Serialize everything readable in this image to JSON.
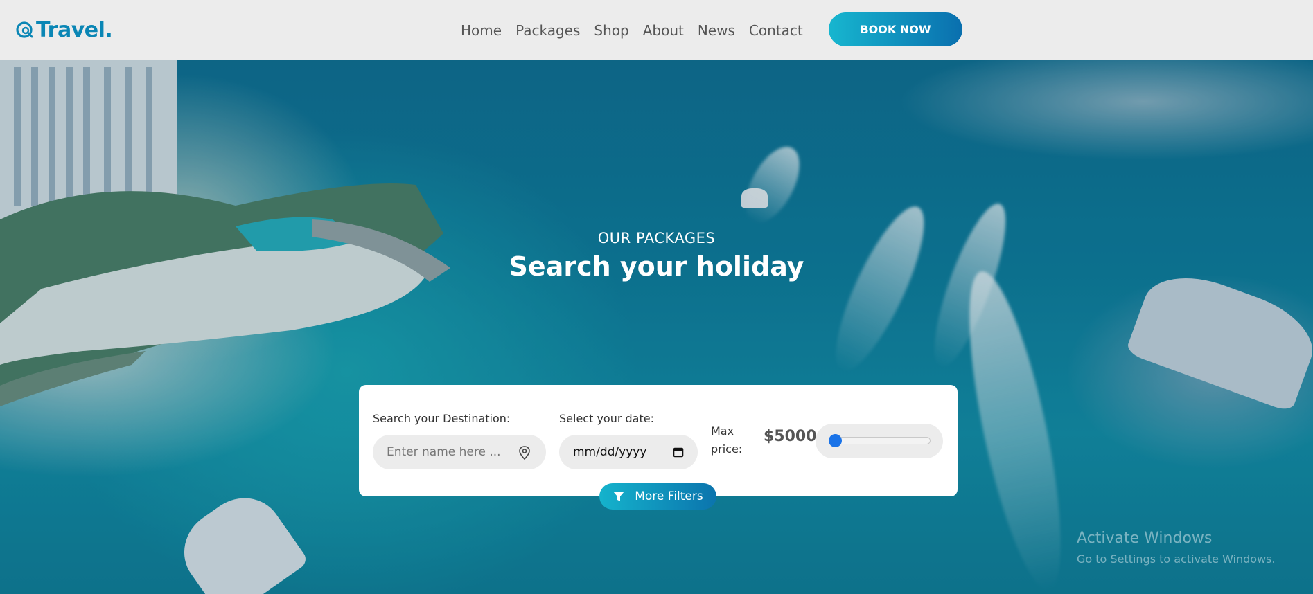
{
  "brand": {
    "name": "Travel."
  },
  "nav": {
    "links": [
      "Home",
      "Packages",
      "Shop",
      "About",
      "News",
      "Contact"
    ],
    "cta": "BOOK NOW"
  },
  "hero": {
    "eyebrow": "OUR PACKAGES",
    "title": "Search your holiday"
  },
  "search": {
    "destination_label": "Search your Destination:",
    "destination_placeholder": "Enter name here ...",
    "date_label": "Select your date:",
    "date_value": "mm/dd/yyyy",
    "max_price_label": "Max price:",
    "max_price_value": "$5000",
    "slider_level": 0,
    "more_filters": "More Filters"
  },
  "watermark": {
    "line1": "Activate Windows",
    "line2": "Go to Settings to activate Windows."
  },
  "colors": {
    "brand": "#0a86b5",
    "button_gradient_start": "#17b6cf",
    "button_gradient_end": "#0a6fae",
    "slider_thumb": "#1a73e8"
  }
}
